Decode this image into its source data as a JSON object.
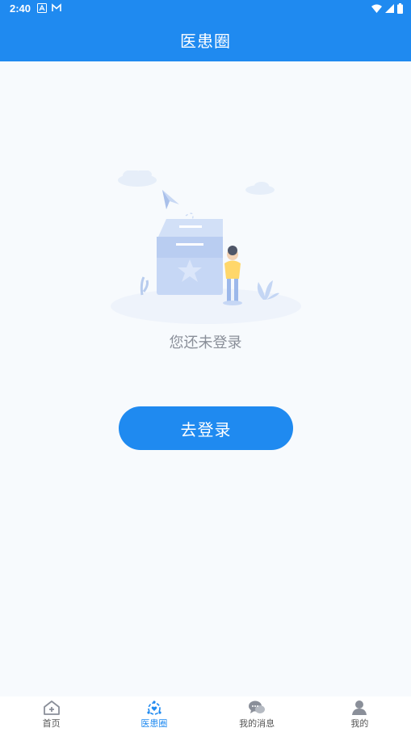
{
  "status_bar": {
    "time": "2:40",
    "left_icons": [
      "font-a-icon",
      "gmail-icon"
    ],
    "right_icons": [
      "wifi-icon",
      "signal-icon",
      "battery-icon"
    ]
  },
  "header": {
    "title": "医患圈"
  },
  "main": {
    "illustration": "empty-box-illustration",
    "empty_message": "您还未登录",
    "login_button_label": "去登录"
  },
  "tabbar": {
    "tabs": [
      {
        "label": "首页",
        "icon": "home-icon",
        "active": false
      },
      {
        "label": "医患圈",
        "icon": "circle-heart-icon",
        "active": true
      },
      {
        "label": "我的消息",
        "icon": "chat-icon",
        "active": false
      },
      {
        "label": "我的",
        "icon": "user-icon",
        "active": false
      }
    ]
  },
  "colors": {
    "primary": "#1f8af0",
    "background": "#f7fafd",
    "muted_text": "#8a8f99"
  }
}
